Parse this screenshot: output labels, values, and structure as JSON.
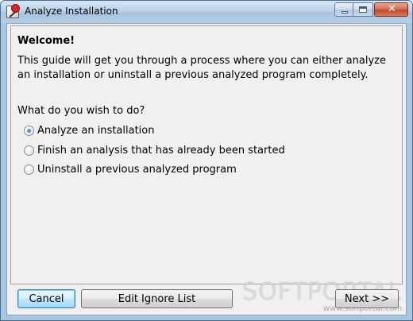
{
  "window": {
    "title": "Analyze Installation",
    "icon": "analyze-installation-app-icon",
    "controls": {
      "minimize_icon": "minimize-icon",
      "maximize_icon": "maximize-icon",
      "close_label": "✕"
    }
  },
  "content": {
    "heading": "Welcome!",
    "intro": "This guide will get you through a process where you can either analyze an installation or uninstall a previous analyzed program completely.",
    "question": "What do you wish to do?",
    "options": [
      {
        "label": "Analyze an installation",
        "selected": true
      },
      {
        "label": "Finish an analysis that has already been started",
        "selected": false
      },
      {
        "label": "Uninstall a previous analyzed program",
        "selected": false
      }
    ]
  },
  "buttons": {
    "cancel": "Cancel",
    "edit_ignore_list": "Edit Ignore List",
    "next": "Next >>"
  },
  "watermark": {
    "brand": "SOFTPORTAL",
    "url": "www.softportal.com"
  }
}
